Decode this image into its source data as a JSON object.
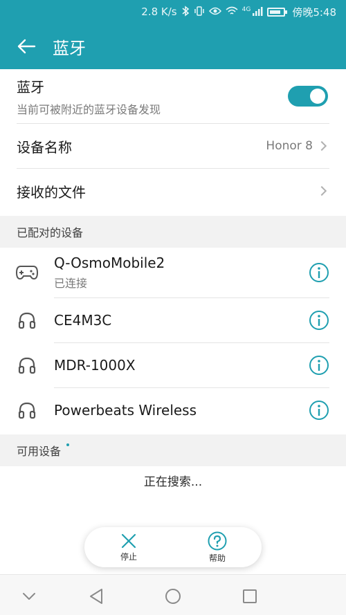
{
  "status_bar": {
    "speed": "2.8 K/s",
    "network_badge": "4G",
    "time": "傍晚5:48",
    "icons": [
      "bluetooth-icon",
      "vibrate-icon",
      "eye-icon",
      "wifi-icon",
      "signal-icon",
      "battery-icon"
    ]
  },
  "app_bar": {
    "title": "蓝牙"
  },
  "bluetooth": {
    "title": "蓝牙",
    "subtitle": "当前可被附近的蓝牙设备发现",
    "enabled": true
  },
  "device_name": {
    "label": "设备名称",
    "value": "Honor 8"
  },
  "received_files": {
    "label": "接收的文件"
  },
  "paired": {
    "header": "已配对的设备",
    "devices": [
      {
        "name": "Q-OsmoMobile2",
        "status": "已连接",
        "icon": "gamepad-icon"
      },
      {
        "name": "CE4M3C",
        "icon": "headphones-icon"
      },
      {
        "name": "MDR-1000X",
        "icon": "headphones-icon"
      },
      {
        "name": "Powerbeats Wireless",
        "icon": "headphones-icon"
      }
    ]
  },
  "available": {
    "header": "可用设备",
    "searching": "正在搜索..."
  },
  "actions": {
    "stop": "停止",
    "help": "帮助"
  },
  "colors": {
    "accent": "#1f9fb0"
  }
}
